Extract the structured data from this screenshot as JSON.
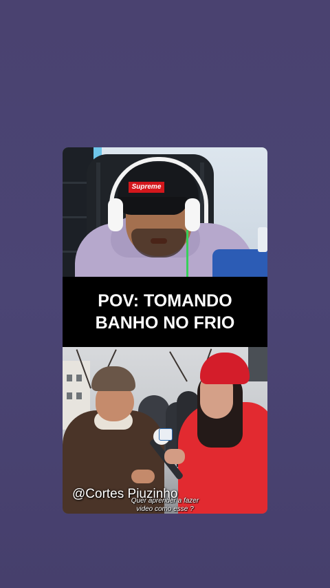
{
  "caption": {
    "line1": "POV: TOMANDO",
    "line2": "BANHO NO FRIO"
  },
  "top_video": {
    "cap_logo_text": "Supreme"
  },
  "watermark": "@Cortes Piuzinho",
  "subtitle": {
    "line1": "Quer aprender a fazer",
    "line2": "video como esse ?"
  },
  "colors": {
    "background": "#4a4270",
    "caption_band": "#000000",
    "caption_text": "#ffffff",
    "jacket_red": "#e22a30"
  }
}
